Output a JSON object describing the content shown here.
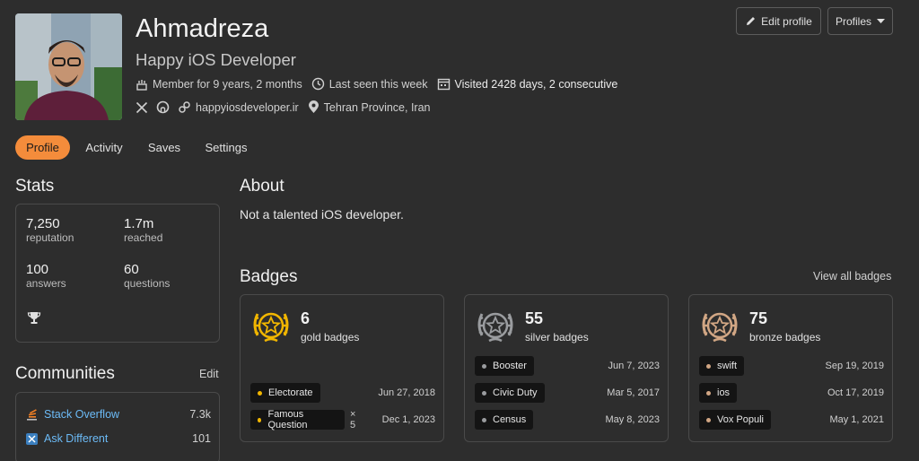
{
  "profile": {
    "name": "Ahmadreza",
    "tagline": "Happy iOS Developer",
    "member_for": "Member for 9 years, 2 months",
    "last_seen": "Last seen this week",
    "visited": "Visited 2428 days, 2 consecutive",
    "website": "happyiosdeveloper.ir",
    "location": "Tehran Province, Iran"
  },
  "header_buttons": {
    "edit": "Edit profile",
    "profiles": "Profiles"
  },
  "tabs": [
    {
      "label": "Profile",
      "active": true
    },
    {
      "label": "Activity"
    },
    {
      "label": "Saves"
    },
    {
      "label": "Settings"
    }
  ],
  "stats": {
    "title": "Stats",
    "items": [
      {
        "value": "7,250",
        "label": "reputation"
      },
      {
        "value": "1.7m",
        "label": "reached"
      },
      {
        "value": "100",
        "label": "answers"
      },
      {
        "value": "60",
        "label": "questions"
      }
    ]
  },
  "about": {
    "title": "About",
    "text": "Not a talented iOS developer."
  },
  "communities": {
    "title": "Communities",
    "edit": "Edit",
    "items": [
      {
        "name": "Stack Overflow",
        "rep": "7.3k"
      },
      {
        "name": "Ask Different",
        "rep": "101"
      }
    ]
  },
  "badges": {
    "title": "Badges",
    "view_all": "View all badges",
    "groups": [
      {
        "count": "6",
        "label": "gold badges",
        "color": "#f1b600",
        "items": [
          {
            "name": "Electorate",
            "multiplier": "",
            "date": "Jun 27, 2018"
          },
          {
            "name": "Famous Question",
            "multiplier": "× 5",
            "date": "Dec 1, 2023"
          }
        ]
      },
      {
        "count": "55",
        "label": "silver badges",
        "color": "#9a9c9f",
        "items": [
          {
            "name": "Booster",
            "multiplier": "",
            "date": "Jun 7, 2023"
          },
          {
            "name": "Civic Duty",
            "multiplier": "",
            "date": "Mar 5, 2017"
          },
          {
            "name": "Census",
            "multiplier": "",
            "date": "May 8, 2023"
          }
        ]
      },
      {
        "count": "75",
        "label": "bronze badges",
        "color": "#d1a684",
        "items": [
          {
            "name": "swift",
            "multiplier": "",
            "date": "Sep 19, 2019"
          },
          {
            "name": "ios",
            "multiplier": "",
            "date": "Oct 17, 2019"
          },
          {
            "name": "Vox Populi",
            "multiplier": "",
            "date": "May 1, 2021"
          }
        ]
      }
    ]
  }
}
